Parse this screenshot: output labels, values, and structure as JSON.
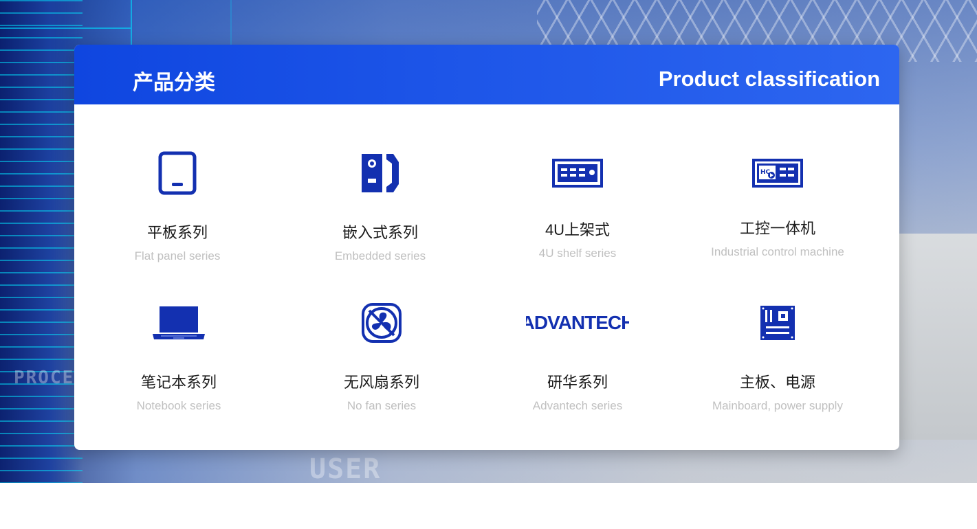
{
  "header": {
    "title_cn": "产品分类",
    "title_en": "Product classification"
  },
  "categories": [
    {
      "name_cn": "平板系列",
      "name_en": "Flat panel series",
      "icon": "tablet-icon"
    },
    {
      "name_cn": "嵌入式系列",
      "name_en": "Embedded series",
      "icon": "embedded-pc-icon"
    },
    {
      "name_cn": "4U上架式",
      "name_en": "4U shelf series",
      "icon": "rack-4u-icon"
    },
    {
      "name_cn": "工控一体机",
      "name_en": "Industrial control machine",
      "icon": "panel-pc-icon"
    },
    {
      "name_cn": "笔记本系列",
      "name_en": "Notebook series",
      "icon": "laptop-icon"
    },
    {
      "name_cn": "无风扇系列",
      "name_en": "No fan series",
      "icon": "no-fan-icon"
    },
    {
      "name_cn": "研华系列",
      "name_en": "Advantech series",
      "icon": "advantech-logo"
    },
    {
      "name_cn": "主板、电源",
      "name_en": "Mainboard, power supply",
      "icon": "mainboard-icon"
    }
  ],
  "brand_logo_text": "ADVANTECH",
  "icon_color": "#1330b0",
  "header_color": "#1d55e8",
  "background_text": [
    "PROCESS",
    "USER"
  ]
}
